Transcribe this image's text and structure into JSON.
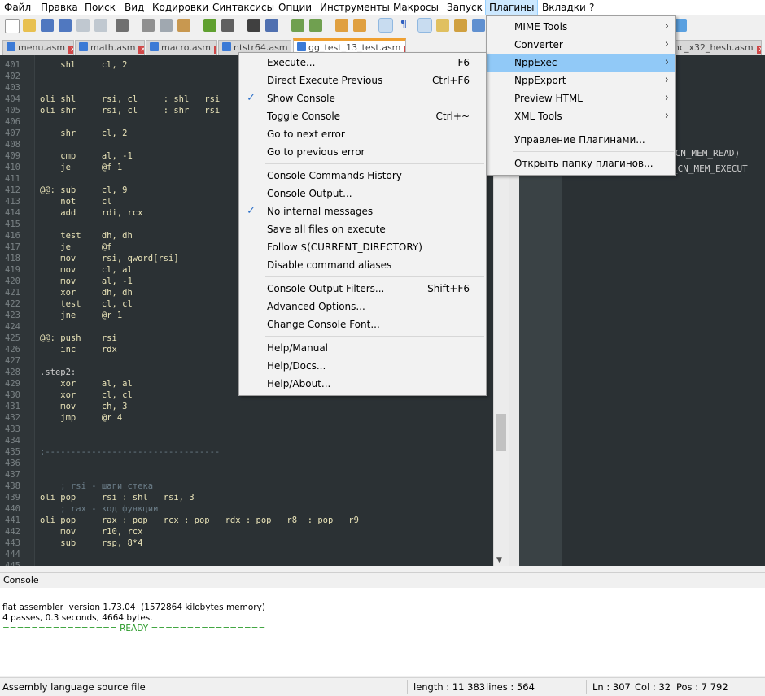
{
  "menubar": [
    "Файл",
    "Правка",
    "Поиск",
    "Вид",
    "Кодировки",
    "Синтаксисы",
    "Опции",
    "Инструменты",
    "Макросы",
    "Запуск",
    "Плагины",
    "Вкладки",
    "?"
  ],
  "tabs": [
    "menu.asm",
    "math.asm",
    "macro.asm",
    "ntstr64.asm",
    "gg_test_13_test.asm",
    "unc_x32_hesh.asm"
  ],
  "code_lines": [
    {
      "n": "401",
      "t": "    shl     cl, 2"
    },
    {
      "n": "402",
      "t": ""
    },
    {
      "n": "403",
      "t": ""
    },
    {
      "n": "404",
      "t": "oli shl     rsi, cl     : shl   rsi"
    },
    {
      "n": "405",
      "t": "oli shr     rsi, cl     : shr   rsi"
    },
    {
      "n": "406",
      "t": ""
    },
    {
      "n": "407",
      "t": "    shr     cl, 2"
    },
    {
      "n": "408",
      "t": ""
    },
    {
      "n": "409",
      "t": "    cmp     al, -1"
    },
    {
      "n": "410",
      "t": "    je      @f 1"
    },
    {
      "n": "411",
      "t": ""
    },
    {
      "n": "412",
      "t": "@@: sub     cl, 9"
    },
    {
      "n": "413",
      "t": "    not     cl"
    },
    {
      "n": "414",
      "t": "    add     rdi, rcx"
    },
    {
      "n": "415",
      "t": ""
    },
    {
      "n": "416",
      "t": "    test    dh, dh"
    },
    {
      "n": "417",
      "t": "    je      @f"
    },
    {
      "n": "418",
      "t": "    mov     rsi, qword[rsi]"
    },
    {
      "n": "419",
      "t": "    mov     cl, al"
    },
    {
      "n": "420",
      "t": "    mov     al, -1"
    },
    {
      "n": "421",
      "t": "    xor     dh, dh"
    },
    {
      "n": "422",
      "t": "    test    cl, cl"
    },
    {
      "n": "423",
      "t": "    jne     @r 1"
    },
    {
      "n": "424",
      "t": ""
    },
    {
      "n": "425",
      "t": "@@: push    rsi"
    },
    {
      "n": "426",
      "t": "    inc     rdx"
    },
    {
      "n": "427",
      "t": ""
    },
    {
      "n": "428",
      "t": ".step2:"
    },
    {
      "n": "429",
      "t": "    xor     al, al"
    },
    {
      "n": "430",
      "t": "    xor     cl, cl"
    },
    {
      "n": "431",
      "t": "    mov     ch, 3"
    },
    {
      "n": "432",
      "t": "    jmp     @r 4"
    },
    {
      "n": "433",
      "t": ""
    },
    {
      "n": "434",
      "t": ""
    },
    {
      "n": "435",
      "t": ";----------------------------------"
    },
    {
      "n": "436",
      "t": ""
    },
    {
      "n": "437",
      "t": ""
    },
    {
      "n": "438",
      "t": "    ; rsi - шаги стека"
    },
    {
      "n": "439",
      "t": "oli pop     rsi : shl   rsi, 3"
    },
    {
      "n": "440",
      "t": "    ; rax - код функции"
    },
    {
      "n": "441",
      "t": "oli pop     rax : pop   rcx : pop   rdx : pop   r8  : pop   r9"
    },
    {
      "n": "442",
      "t": "    mov     r10, rcx"
    },
    {
      "n": "443",
      "t": "    sub     rsp, 8*4"
    },
    {
      "n": "444",
      "t": ""
    },
    {
      "n": "445",
      "t": ""
    }
  ],
  "right_code": [
    "SCN_MEM_READ)",
    "_CN_MEM_EXECUT"
  ],
  "console": {
    "title": "Console",
    "lines": [
      "flat assembler  version 1.73.04  (1572864 kilobytes memory)",
      "4 passes, 0.3 seconds, 4664 bytes.",
      "================ READY ================"
    ]
  },
  "status": {
    "filetype": "Assembly language source file",
    "length": "length : 11 383",
    "lines": "lines : 564",
    "ln": "Ln : 307",
    "col": "Col : 32",
    "pos": "Pos : 7 792"
  },
  "plugins_menu": [
    {
      "label": "MIME Tools",
      "arrow": true
    },
    {
      "label": "Converter",
      "arrow": true
    },
    {
      "label": "NppExec",
      "arrow": true,
      "highlight": true
    },
    {
      "label": "NppExport",
      "arrow": true
    },
    {
      "label": "Preview HTML",
      "arrow": true
    },
    {
      "label": "XML Tools",
      "arrow": true
    },
    {
      "label": "Управление Плагинами..."
    },
    {
      "label": "Открыть папку плагинов..."
    }
  ],
  "nppexec_menu": [
    {
      "label": "Execute...",
      "shortcut": "F6"
    },
    {
      "label": "Direct Execute Previous",
      "shortcut": "Ctrl+F6"
    },
    {
      "label": "Show Console",
      "checked": true
    },
    {
      "label": "Toggle Console",
      "shortcut": "Ctrl+~"
    },
    {
      "label": "Go to next error"
    },
    {
      "label": "Go to previous error"
    },
    {
      "label": "Console Commands History"
    },
    {
      "label": "Console Output..."
    },
    {
      "label": "No internal messages",
      "checked": true
    },
    {
      "label": "Save all files on execute"
    },
    {
      "label": "Follow $(CURRENT_DIRECTORY)"
    },
    {
      "label": "Disable command aliases"
    },
    {
      "label": "Console Output Filters...",
      "shortcut": "Shift+F6"
    },
    {
      "label": "Advanced Options..."
    },
    {
      "label": "Change Console Font..."
    },
    {
      "label": "Help/Manual"
    },
    {
      "label": "Help/Docs..."
    },
    {
      "label": "Help/About..."
    }
  ]
}
